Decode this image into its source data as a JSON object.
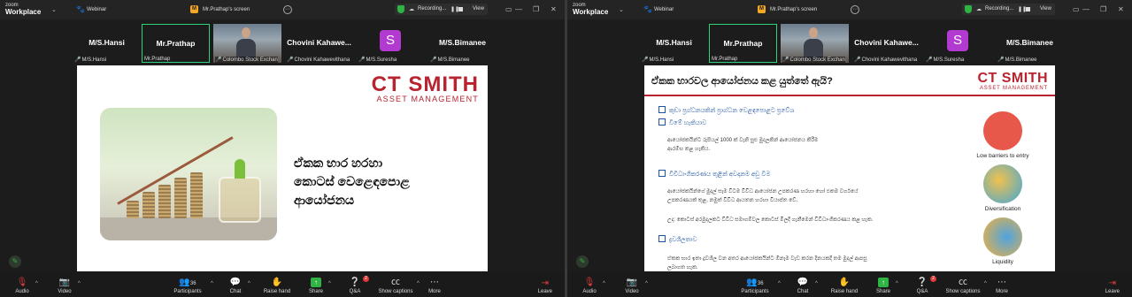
{
  "app": {
    "logo_line1": "zoom",
    "logo_line2": "Workplace",
    "tab": "Webinar",
    "share_label": "Mr.Prathap's screen",
    "recording": "Recording...",
    "view": "View"
  },
  "participants": [
    {
      "name": "M/S.Hansi",
      "sub": "M/S.Hansi",
      "type": "name"
    },
    {
      "name": "Mr.Prathap",
      "sub": "Mr.Prathap",
      "type": "name",
      "active": true
    },
    {
      "name": "",
      "sub": "Colombo Stock Exchan",
      "type": "video"
    },
    {
      "name": "Chovini  Kahawe...",
      "sub": "Chovini Kahawevithana",
      "type": "name"
    },
    {
      "name": "",
      "sub": "M/S.Suresha",
      "type": "avatar",
      "avatar": "S"
    },
    {
      "name": "M/S.Bimanee",
      "sub": "M/S.Bimanee",
      "type": "name"
    }
  ],
  "slide1": {
    "logo_main": "CT SMITH",
    "logo_sub": "ASSET MANAGEMENT",
    "title_line1": "ඒකක භාර හරහා",
    "title_line2": "කොටස් වෙළෙඳපොළ",
    "title_line3": "ආයෝජනය"
  },
  "slide2": {
    "heading": "ඒකක භාරවල ආයෝජනය කළ යුත්තේ ඇයි?",
    "logo_main": "CT SMITH",
    "logo_sub": "ASSET MANAGEMENT",
    "b1": "කුඩා ප්‍රග්ධනයකින් ප්‍රාග්ධන වෙළඳපොළට ප්‍රවේශ",
    "b1b": "වීමේ හැකියාව",
    "t1": "ආයෝජකයින්ට රුපියල් 1000 ක් වැනි සුළු මුදලකින් ආයෝජනය කිරීම",
    "t1b": "ආරම්භ කළ හැකිය.",
    "b2": "විවිධාංගීකරණය තුළින් අවදානම අඩු වීම",
    "t2": "ආයෝජකයින්ගේ මුදල් සෑම විටම විවිධ ආයෝජන උපකරණ හරහා හෝ එකම වර්ගයේ",
    "t2b": "උපකරණයක් තුළ, නමුත් විවිධ ආයතන හරහා වියාප්ත වේ.",
    "t3": "උදා: කොටස් අරමුදලකට විවිධ සමාගම්වල කොටස් මිලදී ගැනීමෙන් විවිධාංගීකරණය කළ හැක.",
    "b3": "ද්‍රවශීලතාව",
    "t4": "ඒකක භාර ඉතා ද්‍රවශීල වන අතර ආයෝජකයින්ට ඕනෑම වැඩ කරන දිනයකදී තම මුදල් ආපසු",
    "t4b": "ලබාගත හැක.",
    "icons": [
      "Low barriers to entry",
      "Diversification",
      "Liquidity"
    ]
  },
  "toolbar": {
    "audio": "Audio",
    "video": "Video",
    "participants": "Participants",
    "participants_count": "36",
    "chat": "Chat",
    "raise_hand": "Raise hand",
    "share": "Share",
    "qa": "Q&A",
    "qa_badge": "2",
    "captions": "Show captions",
    "more": "More",
    "leave": "Leave"
  },
  "colors": {
    "brand_red": "#b8232f",
    "brand_blue": "#1f3f7a",
    "active_green": "#2fd37a",
    "mute_red": "#e03b3b"
  }
}
